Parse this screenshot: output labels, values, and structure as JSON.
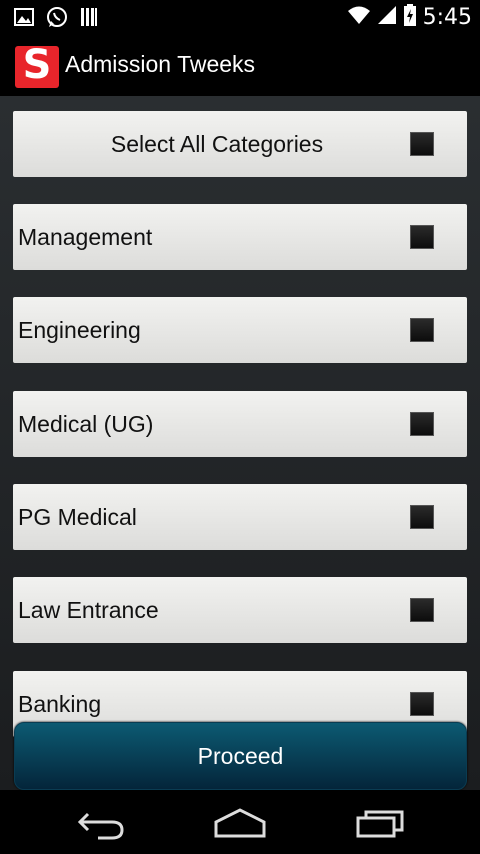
{
  "status_bar": {
    "time": "5:45",
    "icons_left": [
      "image-icon",
      "whatsapp-icon",
      "storage-icon"
    ],
    "icons_right": [
      "wifi-icon",
      "signal-icon",
      "battery-charging-icon"
    ]
  },
  "action_bar": {
    "logo_letter": "S",
    "title": "Admission Tweeks"
  },
  "categories": {
    "select_all": "Select All Categories",
    "items": [
      "Management",
      "Engineering",
      "Medical (UG)",
      "PG Medical",
      "Law Entrance",
      "Banking"
    ]
  },
  "buttons": {
    "proceed": "Proceed"
  },
  "colors": {
    "logo": "#e8252b",
    "proceed_button": "#0c5a72"
  }
}
